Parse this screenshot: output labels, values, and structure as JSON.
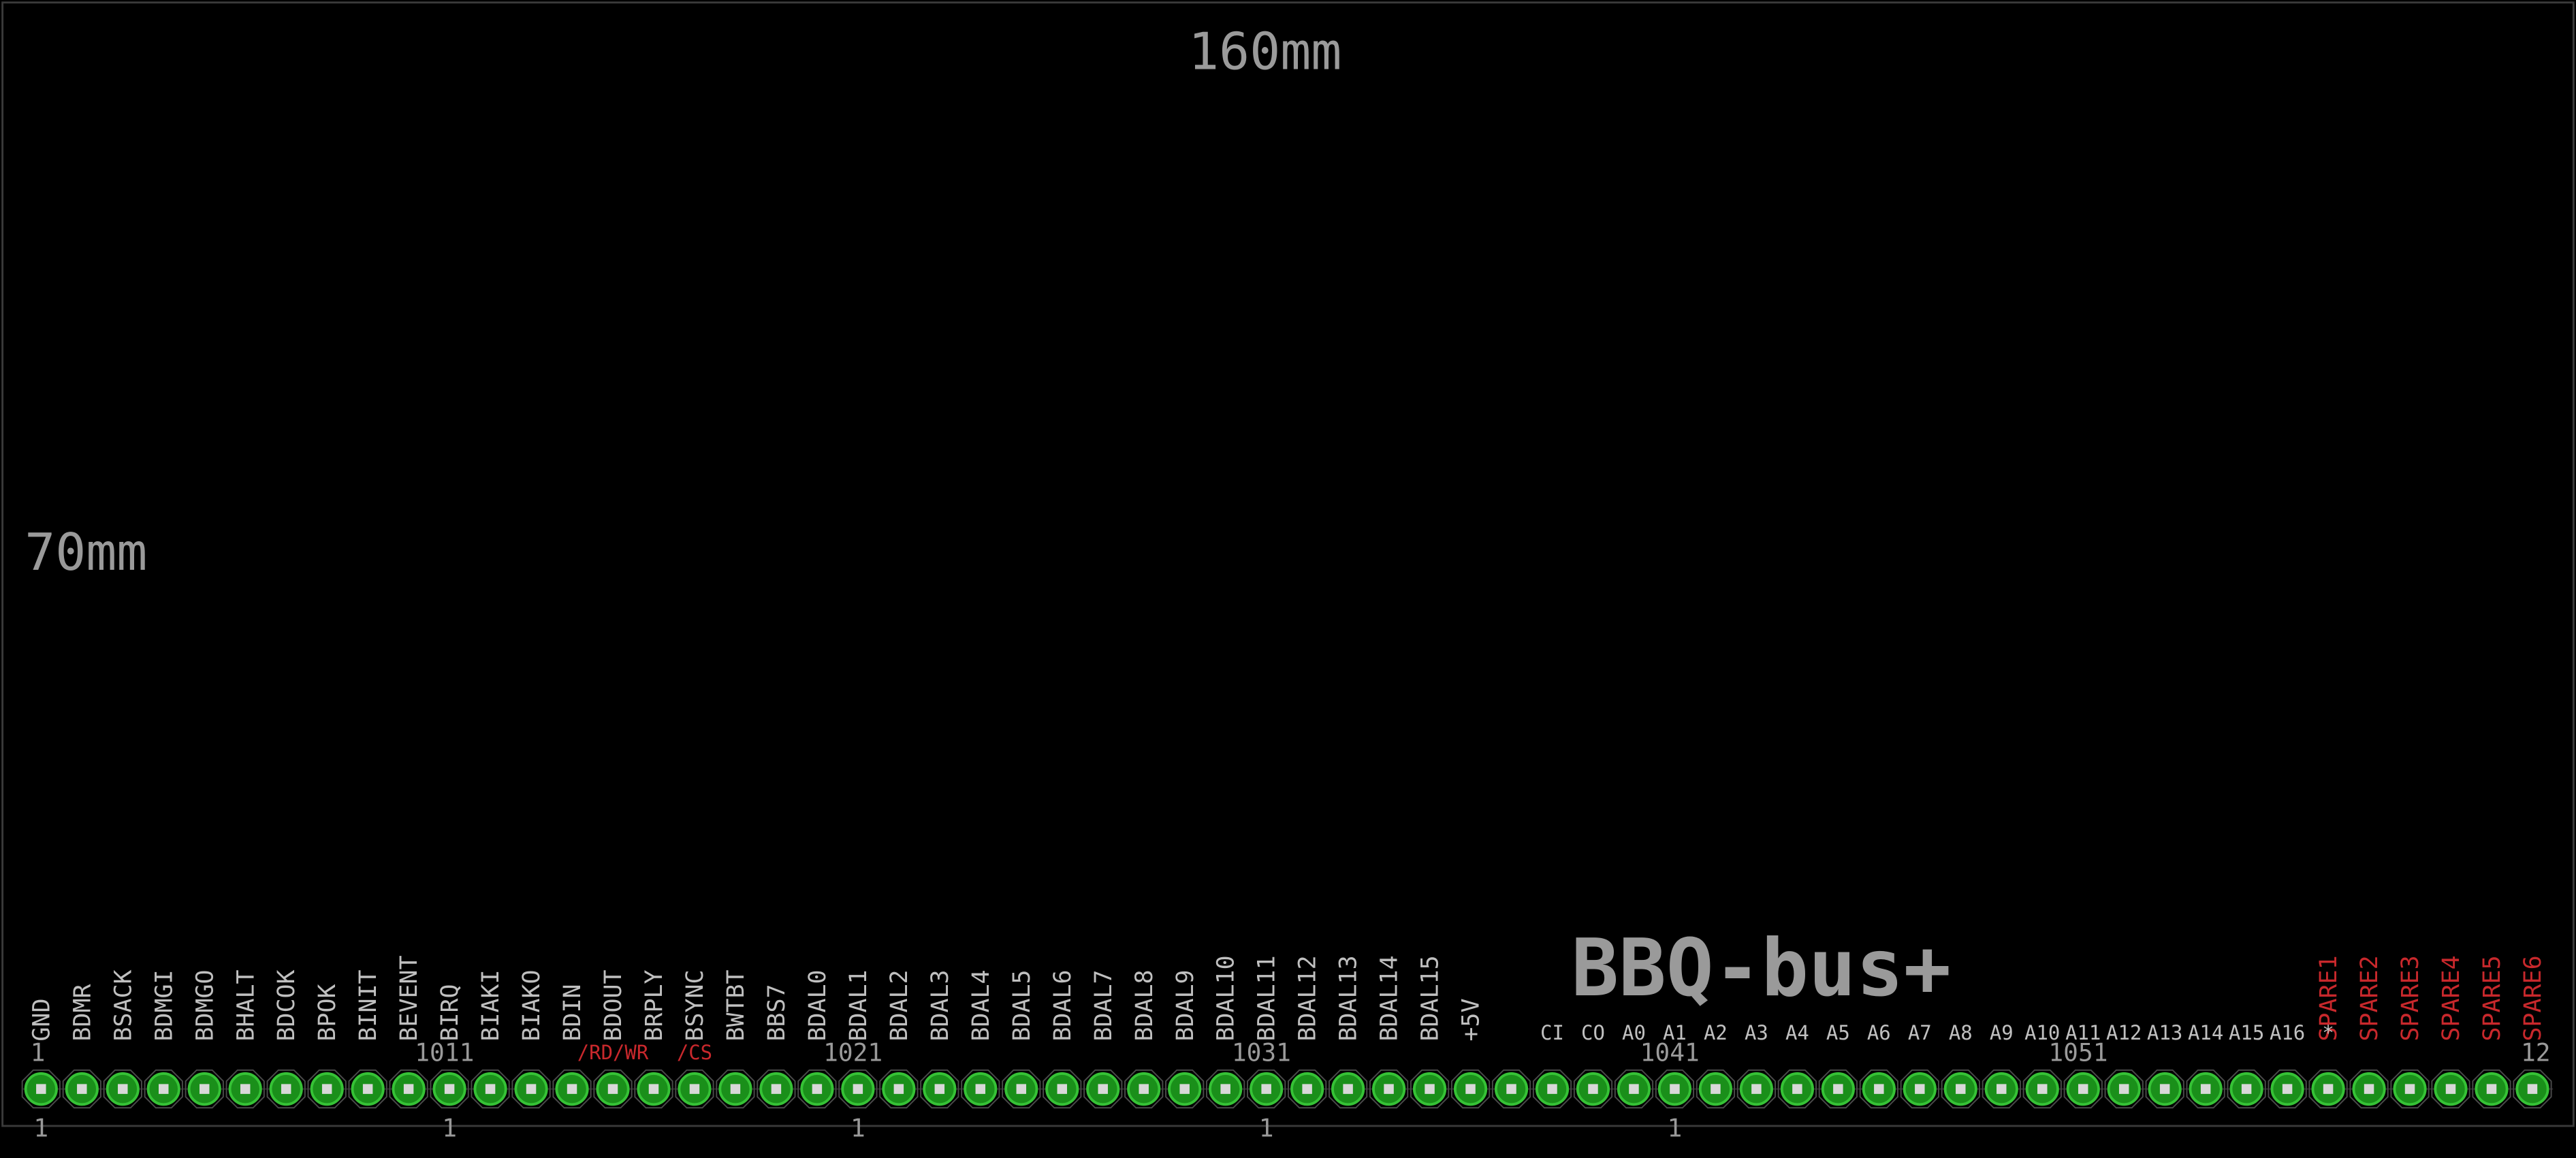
{
  "colors": {
    "background": "#000000",
    "outline": "#3a3a3a",
    "silk": "#c0c0c0",
    "dim": "#9a9a9a",
    "red": "#c8282c",
    "pad_fill": "#1a8f1a",
    "pad_ring": "#36c236",
    "pad_hole": "#d8d8d8"
  },
  "dimensions": {
    "width_label": "160mm",
    "height_label": "70mm"
  },
  "title": "BBQ-bus+",
  "connector": {
    "pin_count": 62,
    "first_pin_label": "1",
    "last_pin_label": "12",
    "group_start_labels": [
      "1",
      "1",
      "1",
      "1",
      "1"
    ],
    "group_end_labels": [
      "10",
      "10",
      "10",
      "10",
      "10"
    ],
    "group_next_labels": [
      "11",
      "21",
      "31",
      "41",
      "51"
    ]
  },
  "signals": [
    {
      "label": "GND",
      "pin": 1,
      "color": "silk"
    },
    {
      "label": "BDMR",
      "pin": 2,
      "color": "silk"
    },
    {
      "label": "BSACK",
      "pin": 3,
      "color": "silk"
    },
    {
      "label": "BDMGI",
      "pin": 4,
      "color": "silk"
    },
    {
      "label": "BDMGO",
      "pin": 5,
      "color": "silk"
    },
    {
      "label": "BHALT",
      "pin": 6,
      "color": "silk"
    },
    {
      "label": "BDCOK",
      "pin": 7,
      "color": "silk"
    },
    {
      "label": "BPOK",
      "pin": 8,
      "color": "silk"
    },
    {
      "label": "BINIT",
      "pin": 9,
      "color": "silk"
    },
    {
      "label": "BEVENT",
      "pin": 10,
      "color": "silk"
    },
    {
      "label": "BIRQ",
      "pin": 11,
      "color": "silk"
    },
    {
      "label": "BIAKI",
      "pin": 12,
      "color": "silk"
    },
    {
      "label": "BIAKO",
      "pin": 13,
      "color": "silk"
    },
    {
      "label": "BDIN",
      "pin": 14,
      "color": "silk"
    },
    {
      "label": "BDOUT",
      "pin": 15,
      "color": "silk"
    },
    {
      "label": "BRPLY",
      "pin": 16,
      "color": "silk"
    },
    {
      "label": "BSYNC",
      "pin": 17,
      "color": "silk"
    },
    {
      "label": "BWTBT",
      "pin": 18,
      "color": "silk"
    },
    {
      "label": "BBS7",
      "pin": 19,
      "color": "silk"
    },
    {
      "label": "BDAL0",
      "pin": 20,
      "color": "silk"
    },
    {
      "label": "BDAL1",
      "pin": 21,
      "color": "silk"
    },
    {
      "label": "BDAL2",
      "pin": 22,
      "color": "silk"
    },
    {
      "label": "BDAL3",
      "pin": 23,
      "color": "silk"
    },
    {
      "label": "BDAL4",
      "pin": 24,
      "color": "silk"
    },
    {
      "label": "BDAL5",
      "pin": 25,
      "color": "silk"
    },
    {
      "label": "BDAL6",
      "pin": 26,
      "color": "silk"
    },
    {
      "label": "BDAL7",
      "pin": 27,
      "color": "silk"
    },
    {
      "label": "BDAL8",
      "pin": 28,
      "color": "silk"
    },
    {
      "label": "BDAL9",
      "pin": 29,
      "color": "silk"
    },
    {
      "label": "BDAL10",
      "pin": 30,
      "color": "silk"
    },
    {
      "label": "BDAL11",
      "pin": 31,
      "color": "silk"
    },
    {
      "label": "BDAL12",
      "pin": 32,
      "color": "silk"
    },
    {
      "label": "BDAL13",
      "pin": 33,
      "color": "silk"
    },
    {
      "label": "BDAL14",
      "pin": 34,
      "color": "silk"
    },
    {
      "label": "BDAL15",
      "pin": 35,
      "color": "silk"
    },
    {
      "label": "+5V",
      "pin": 36,
      "color": "silk"
    },
    {
      "label": "SPARE1",
      "pin": 57,
      "color": "red"
    },
    {
      "label": "SPARE2",
      "pin": 58,
      "color": "red"
    },
    {
      "label": "SPARE3",
      "pin": 59,
      "color": "red"
    },
    {
      "label": "SPARE4",
      "pin": 60,
      "color": "red"
    },
    {
      "label": "SPARE5",
      "pin": 61,
      "color": "red"
    },
    {
      "label": "SPARE6",
      "pin": 62,
      "color": "red"
    }
  ],
  "alt_signals": [
    {
      "label": "/RD/WR",
      "pin": 15
    },
    {
      "label": "/CS",
      "pin": 17
    }
  ],
  "address_labels": [
    {
      "label": "CI",
      "pin": 38
    },
    {
      "label": "CO",
      "pin": 39
    },
    {
      "label": "A0",
      "pin": 40
    },
    {
      "label": "A1",
      "pin": 41
    },
    {
      "label": "A2",
      "pin": 42
    },
    {
      "label": "A3",
      "pin": 43
    },
    {
      "label": "A4",
      "pin": 44
    },
    {
      "label": "A5",
      "pin": 45
    },
    {
      "label": "A6",
      "pin": 46
    },
    {
      "label": "A7",
      "pin": 47
    },
    {
      "label": "A8",
      "pin": 48
    },
    {
      "label": "A9",
      "pin": 49
    },
    {
      "label": "A10",
      "pin": 50
    },
    {
      "label": "A11",
      "pin": 51
    },
    {
      "label": "A12",
      "pin": 52
    },
    {
      "label": "A13",
      "pin": 53
    },
    {
      "label": "A14",
      "pin": 54
    },
    {
      "label": "A15",
      "pin": 55
    },
    {
      "label": "A16",
      "pin": 56
    },
    {
      "label": "*",
      "pin": 57
    }
  ]
}
